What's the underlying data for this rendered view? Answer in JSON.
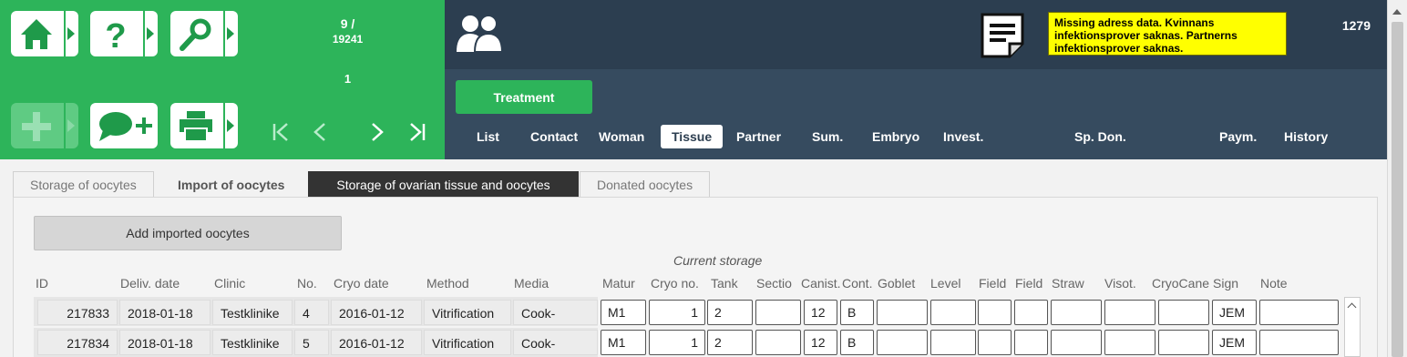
{
  "toolbar": {
    "tiles": [
      {
        "icon": "home-icon"
      },
      {
        "icon": "help-icon"
      },
      {
        "icon": "search-icon"
      },
      {
        "icon": "add-icon",
        "disabled": true
      },
      {
        "icon": "add-comment-icon"
      },
      {
        "icon": "printer-icon"
      }
    ]
  },
  "navigation": {
    "record_position": "9 /",
    "record_total": "19241",
    "sub_position": "1"
  },
  "header": {
    "warning": "Missing adress data. Kvinnans infektionsprover saknas. Partnerns infektionsprover saknas.",
    "number": "1279",
    "treatment_label": "Treatment"
  },
  "main_tabs": [
    {
      "label": "List",
      "active": false
    },
    {
      "label": "Contact",
      "active": false
    },
    {
      "label": "Woman",
      "active": false
    },
    {
      "label": "Tissue",
      "active": true
    },
    {
      "label": "Partner",
      "active": false
    },
    {
      "label": "Sum.",
      "active": false
    },
    {
      "label": "Embryo",
      "active": false
    },
    {
      "label": "Invest.",
      "active": false
    },
    {
      "label": "Sp. Don.",
      "active": false
    },
    {
      "label": "Paym.",
      "active": false
    },
    {
      "label": "History",
      "active": false
    }
  ],
  "sub_tabs": [
    {
      "label": "Storage of oocytes"
    },
    {
      "label": "Import of oocytes"
    },
    {
      "label": "Storage of ovarian tissue and oocytes"
    },
    {
      "label": "Donated oocytes"
    }
  ],
  "content": {
    "add_button": "Add imported oocytes",
    "group_label": "Current storage",
    "columns": [
      "ID",
      "Deliv. date",
      "Clinic",
      "No.",
      "Cryo date",
      "Method",
      "Media",
      "Matur",
      "Cryo no.",
      "Tank",
      "Sectio",
      "Canist.",
      "Cont.",
      "Goblet",
      "Level",
      "Field",
      "Field",
      "Straw",
      "Visot.",
      "CryoCane",
      "Sign",
      "Note"
    ],
    "rows": [
      {
        "id": "217833",
        "deliv_date": "2018-01-18",
        "clinic": "Testklinike",
        "no": "4",
        "cryo_date": "2016-01-12",
        "method": "Vitrification",
        "media": "Cook-",
        "matur": "M1",
        "cryo_no": "1",
        "tank": "2",
        "sectio": "",
        "canist": "12",
        "cont": "B",
        "goblet": "",
        "level": "",
        "field1": "",
        "field2": "",
        "straw": "",
        "visot": "",
        "cryocane": "",
        "sign": "JEM",
        "note": ""
      },
      {
        "id": "217834",
        "deliv_date": "2018-01-18",
        "clinic": "Testklinike",
        "no": "5",
        "cryo_date": "2016-01-12",
        "method": "Vitrification",
        "media": "Cook-",
        "matur": "M1",
        "cryo_no": "1",
        "tank": "2",
        "sectio": "",
        "canist": "12",
        "cont": "B",
        "goblet": "",
        "level": "",
        "field1": "",
        "field2": "",
        "straw": "",
        "visot": "",
        "cryocane": "",
        "sign": "JEM",
        "note": ""
      }
    ]
  },
  "colors": {
    "green": "#2db45a",
    "header_dark": "#2c3e50",
    "header_mid": "#364b5f",
    "warning_bg": "#ffff00"
  }
}
